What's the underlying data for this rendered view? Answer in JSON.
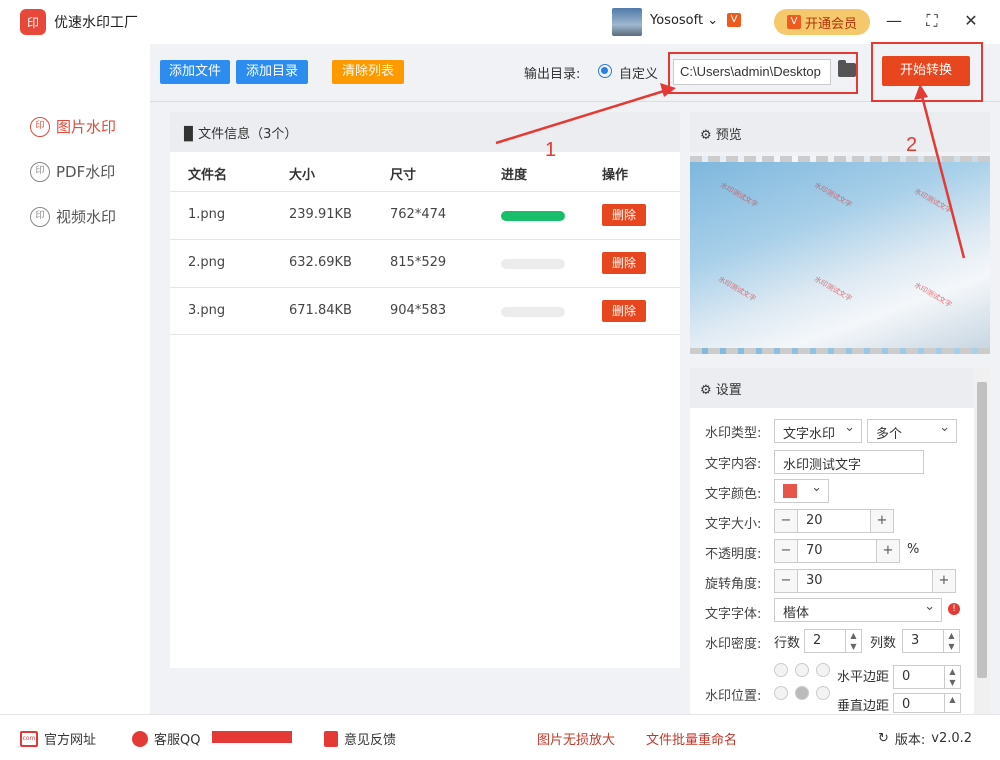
{
  "app": {
    "logo_text": "印",
    "title": "优速水印工厂",
    "username": "Yososoft",
    "vip_mini": "V",
    "vip_label": "开通会员"
  },
  "window": {
    "minimize": "—",
    "maximize": "⛶",
    "close": "✕"
  },
  "sidebar": {
    "items": [
      {
        "icon": "印",
        "label": "图片水印",
        "active": true
      },
      {
        "icon": "印",
        "label": "PDF水印",
        "active": false
      },
      {
        "icon": "印",
        "label": "视频水印",
        "active": false
      }
    ]
  },
  "toolbar": {
    "add_file": "添加文件",
    "add_dir": "添加目录",
    "clear_list": "清除列表",
    "output_label": "输出目录:",
    "custom_label": "自定义",
    "path_value": "C:\\Users\\admin\\Desktop",
    "start": "开始转换",
    "colors": {
      "blue": "#2d8cf0",
      "orange": "#ff9900",
      "start": "#e8461e"
    }
  },
  "files": {
    "header": "文件信息（3个）",
    "columns": [
      "文件名",
      "大小",
      "尺寸",
      "进度",
      "操作"
    ],
    "rows": [
      {
        "name": "1.png",
        "size": "239.91KB",
        "dims": "762*474",
        "progress": 1.0,
        "action": "删除"
      },
      {
        "name": "2.png",
        "size": "632.69KB",
        "dims": "815*529",
        "progress": 0.0,
        "action": "删除"
      },
      {
        "name": "3.png",
        "size": "671.84KB",
        "dims": "904*583",
        "progress": 0.0,
        "action": "删除"
      }
    ]
  },
  "preview": {
    "title": "预览",
    "watermark_text": "水印测试文字"
  },
  "settings": {
    "title": "设置",
    "type_label": "水印类型:",
    "type_value": "文字水印",
    "multi_value": "多个",
    "content_label": "文字内容:",
    "content_value": "水印测试文字",
    "color_label": "文字颜色:",
    "color_value": "#e8534a",
    "size_label": "文字大小:",
    "size_value": "20",
    "opacity_label": "不透明度:",
    "opacity_value": "70",
    "opacity_unit": "%",
    "rotate_label": "旋转角度:",
    "rotate_value": "30",
    "font_label": "文字字体:",
    "font_value": "楷体",
    "density_label": "水印密度:",
    "rows_label": "行数",
    "rows_value": "2",
    "cols_label": "列数",
    "cols_value": "3",
    "position_label": "水印位置:",
    "hmargin_label": "水平边距",
    "hmargin_value": "0",
    "vmargin_label": "垂直边距",
    "vmargin_value": "0"
  },
  "annotations": {
    "one": "1",
    "two": "2",
    "color": "#e53935"
  },
  "footer": {
    "website": "官方网址",
    "qq": "客服QQ",
    "feedback": "意见反馈",
    "enlarge": "图片无损放大",
    "rename": "文件批量重命名",
    "version_label": "版本:",
    "version": "v2.0.2"
  }
}
